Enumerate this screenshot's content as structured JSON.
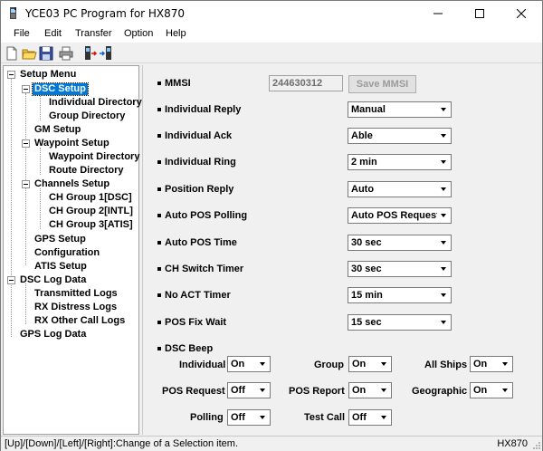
{
  "window": {
    "title": "YCE03 PC Program for HX870"
  },
  "menu": [
    "File",
    "Edit",
    "Transfer",
    "Option",
    "Help"
  ],
  "tree": {
    "root": "Setup Menu",
    "dsc_setup": "DSC Setup",
    "individual_directory": "Individual Directory",
    "group_directory": "Group Directory",
    "gm_setup": "GM Setup",
    "waypoint_setup": "Waypoint Setup",
    "waypoint_directory": "Waypoint Directory",
    "route_directory": "Route Directory",
    "channels_setup": "Channels Setup",
    "ch_group_1": "CH Group 1[DSC]",
    "ch_group_2": "CH Group 2[INTL]",
    "ch_group_3": "CH Group 3[ATIS]",
    "gps_setup": "GPS Setup",
    "configuration": "Configuration",
    "atis_setup": "ATIS Setup",
    "dsc_log_data": "DSC Log Data",
    "transmitted_logs": "Transmitted Logs",
    "rx_distress_logs": "RX Distress Logs",
    "rx_other_call_logs": "RX Other Call Logs",
    "gps_log_data": "GPS Log Data"
  },
  "form": {
    "mmsi": {
      "label": "MMSI",
      "value": "244630312",
      "button": "Save MMSI"
    },
    "individual_reply": {
      "label": "Individual Reply",
      "value": "Manual"
    },
    "individual_ack": {
      "label": "Individual Ack",
      "value": "Able"
    },
    "individual_ring": {
      "label": "Individual Ring",
      "value": "2 min"
    },
    "position_reply": {
      "label": "Position Reply",
      "value": "Auto"
    },
    "auto_pos_polling": {
      "label": "Auto POS Polling",
      "value": "Auto POS Request"
    },
    "auto_pos_time": {
      "label": "Auto POS Time",
      "value": "30 sec"
    },
    "ch_switch_timer": {
      "label": "CH Switch Timer",
      "value": "30 sec"
    },
    "no_act_timer": {
      "label": "No ACT Timer",
      "value": "15 min"
    },
    "pos_fix_wait": {
      "label": "POS Fix Wait",
      "value": "15 sec"
    },
    "dsc_beep": {
      "label": "DSC Beep",
      "individual": {
        "label": "Individual",
        "value": "On"
      },
      "group": {
        "label": "Group",
        "value": "On"
      },
      "all_ships": {
        "label": "All Ships",
        "value": "On"
      },
      "pos_request": {
        "label": "POS Request",
        "value": "Off"
      },
      "pos_report": {
        "label": "POS Report",
        "value": "On"
      },
      "geographic": {
        "label": "Geographic",
        "value": "On"
      },
      "polling": {
        "label": "Polling",
        "value": "Off"
      },
      "test_call": {
        "label": "Test Call",
        "value": "Off"
      }
    }
  },
  "status": {
    "hint": "[Up]/[Down]/[Left]/[Right]:Change of a Selection item.",
    "model": "HX870"
  }
}
